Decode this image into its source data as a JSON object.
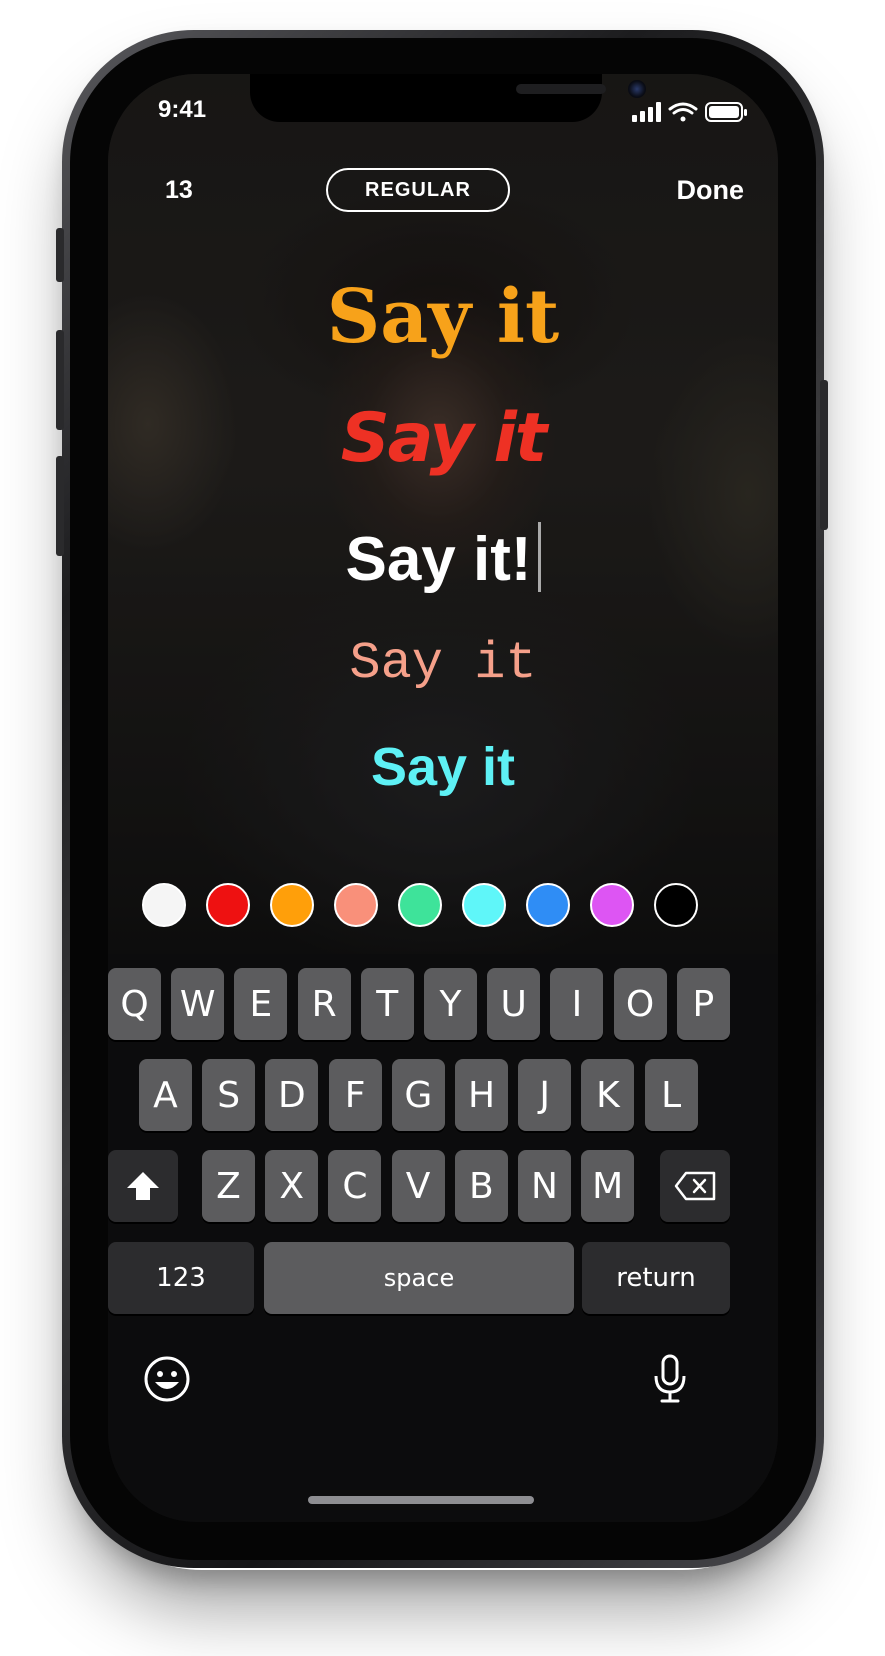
{
  "status_bar": {
    "time": "9:41"
  },
  "editor": {
    "count": "13",
    "style_label": "REGULAR",
    "done_label": "Done"
  },
  "samples": [
    {
      "text": "Say it",
      "color": "#f7a21a"
    },
    {
      "text": "Say it",
      "color": "#ee3124"
    },
    {
      "text": "Say it!",
      "color": "#ffffff"
    },
    {
      "text": "Say it",
      "color": "#f5a08a"
    },
    {
      "text": "Say it",
      "color": "#5ef1f5"
    }
  ],
  "colors": [
    "#f5f5f5",
    "#ee1111",
    "#ff9f0a",
    "#f9907a",
    "#3ee39a",
    "#5ff6f9",
    "#2f8df5",
    "#dd55f3",
    "#000000"
  ],
  "keyboard": {
    "row1": [
      "Q",
      "W",
      "E",
      "R",
      "T",
      "Y",
      "U",
      "I",
      "O",
      "P"
    ],
    "row2": [
      "A",
      "S",
      "D",
      "F",
      "G",
      "H",
      "J",
      "K",
      "L"
    ],
    "row3": [
      "Z",
      "X",
      "C",
      "V",
      "B",
      "N",
      "M"
    ],
    "numbers_label": "123",
    "space_label": "space",
    "return_label": "return"
  },
  "icons": {
    "shift": "shift-icon",
    "delete": "delete-icon",
    "emoji": "emoji-icon",
    "mic": "microphone-icon"
  }
}
